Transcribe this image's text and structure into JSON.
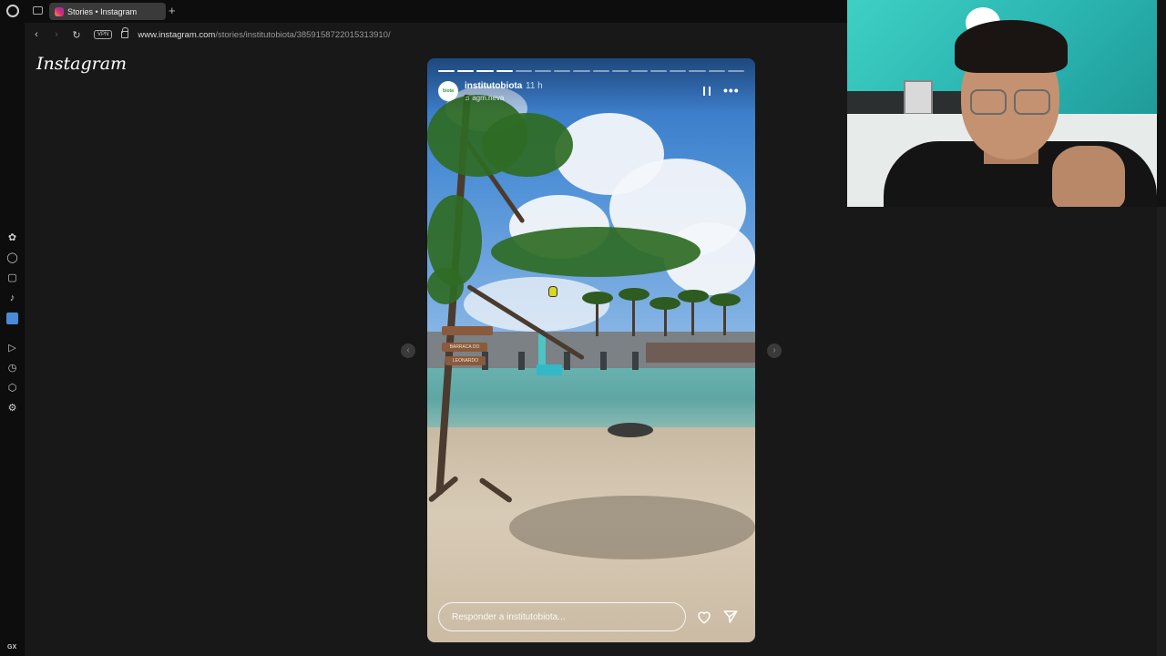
{
  "browser": {
    "tab_title": "Stories • Instagram",
    "vpn_label": "VPN",
    "url_domain": "www.instagram.com",
    "url_path": "/stories/institutobiota/3859158722015313910/"
  },
  "sidebar": {
    "gx_label": "GX",
    "more_label": "···"
  },
  "instagram": {
    "logo": "Instagram"
  },
  "story": {
    "username": "institutobiota",
    "time_ago": "11 h",
    "audio_label": "agm.neva",
    "avatar_text": "biota",
    "reply_placeholder": "Responder a institutobiota...",
    "sign_top": "",
    "sign_mid": "BARRACA DO",
    "sign_bottom": "LEONARDO",
    "progress_total": 16,
    "progress_done": 4
  },
  "colors": {
    "background": "#181818",
    "chrome": "#0d0d0d",
    "webcam_bg": "#2bb5b1"
  }
}
